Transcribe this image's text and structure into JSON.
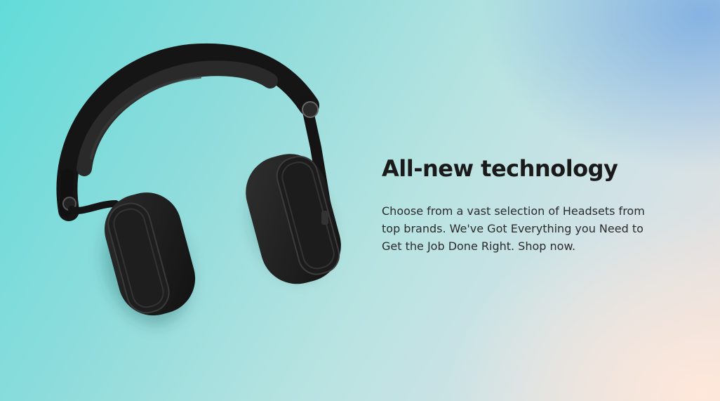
{
  "hero": {
    "title": "All-new technology",
    "description": "Choose from a vast selection of Headsets from top brands. We've Got Everything you Need to Get the Job Done Right. Shop now.",
    "image": {
      "subject": "headphones",
      "icon": "headphones-icon"
    }
  },
  "colors": {
    "background_start": "#62dcd9",
    "background_end": "#ffe8da",
    "heading": "#1a1a1a",
    "body_text": "#2b2b2b",
    "headphones": "#1c1c1c"
  }
}
